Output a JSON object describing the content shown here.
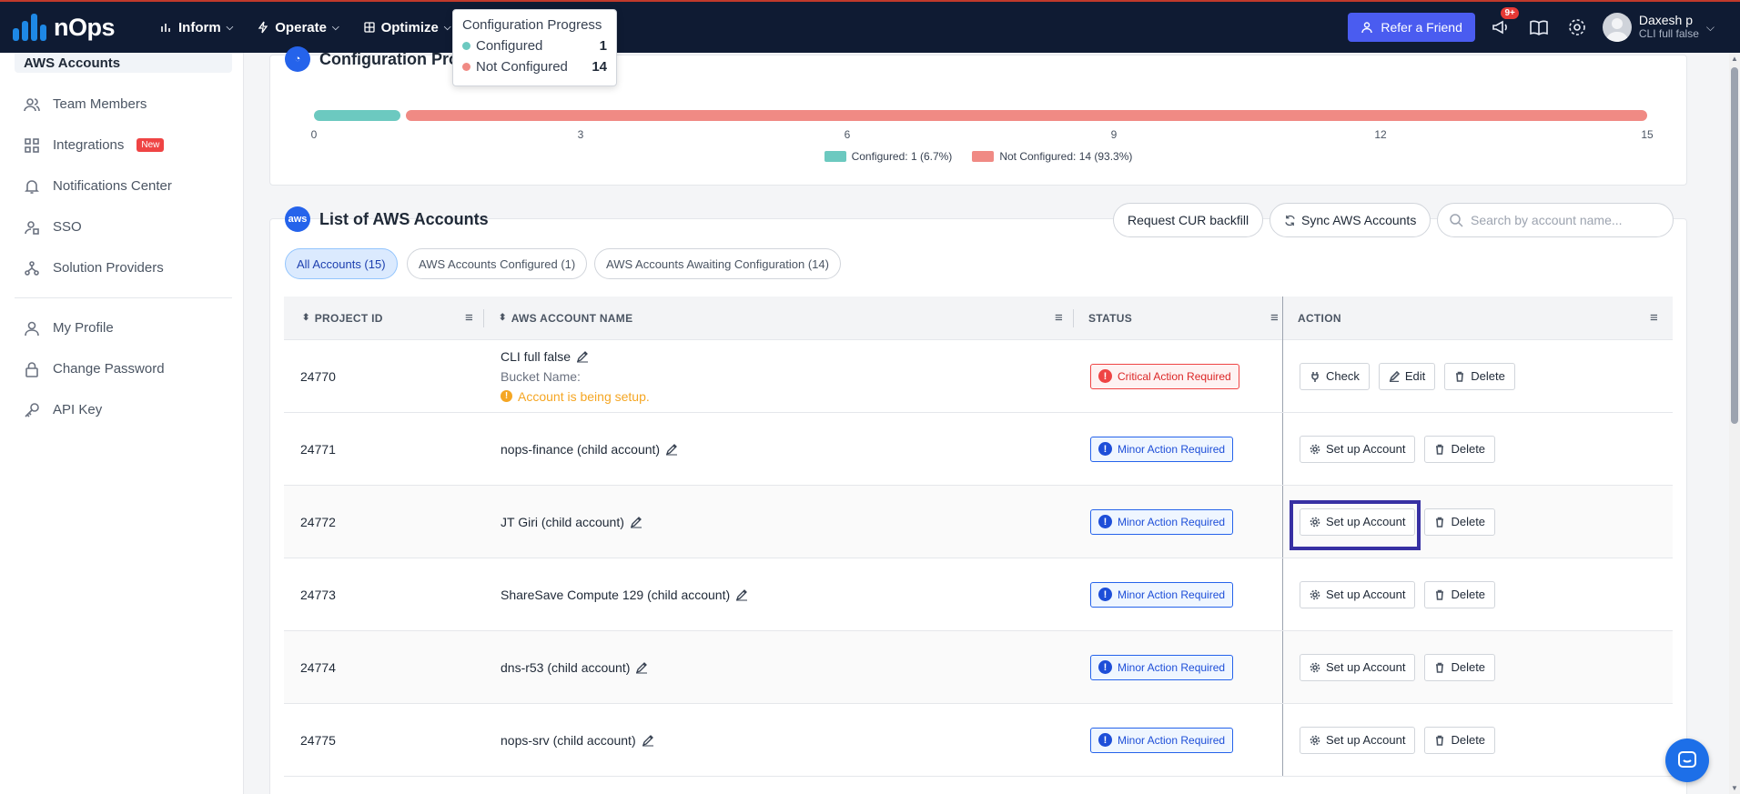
{
  "brand": {
    "name": "nOps"
  },
  "nav": [
    {
      "label": "Inform",
      "icon": "bar-chart-icon"
    },
    {
      "label": "Operate",
      "icon": "bolt-icon"
    },
    {
      "label": "Optimize",
      "icon": "layers-icon"
    }
  ],
  "header": {
    "refer_label": "Refer a Friend",
    "notif_count": "9+",
    "user_name": "Daxesh p",
    "user_sub": "CLI full false"
  },
  "sidebar": {
    "active": "AWS Accounts",
    "items": [
      {
        "label": "Team Members",
        "icon": "users-icon"
      },
      {
        "label": "Integrations",
        "icon": "grid-icon",
        "badge": "New"
      },
      {
        "label": "Notifications Center",
        "icon": "bell-icon"
      },
      {
        "label": "SSO",
        "icon": "sso-icon"
      },
      {
        "label": "Solution Providers",
        "icon": "network-icon"
      }
    ],
    "items2": [
      {
        "label": "My Profile",
        "icon": "user-icon"
      },
      {
        "label": "Change Password",
        "icon": "lock-icon"
      },
      {
        "label": "API Key",
        "icon": "key-icon"
      }
    ]
  },
  "progress": {
    "title": "Configuration Progress",
    "tick_labels": [
      "0",
      "3",
      "6",
      "9",
      "12",
      "15"
    ],
    "legend": [
      "Configured: 1 (6.7%)",
      "Not Configured: 14 (93.3%)"
    ],
    "colors": {
      "configured": "#6cc9c0",
      "not_configured": "#f08a84"
    }
  },
  "chart_data": {
    "type": "bar",
    "orientation": "horizontal-stacked",
    "title": "Configuration Progress",
    "series": [
      {
        "name": "Configured",
        "values": [
          1
        ]
      },
      {
        "name": "Not Configured",
        "values": [
          14
        ]
      }
    ],
    "xlim": [
      0,
      15
    ],
    "ticks": [
      0,
      3,
      6,
      9,
      12,
      15
    ],
    "legend_position": "bottom"
  },
  "tooltip": {
    "title": "Configuration Progress",
    "rows": [
      {
        "label": "Configured",
        "value": "1"
      },
      {
        "label": "Not Configured",
        "value": "14"
      }
    ]
  },
  "accounts": {
    "title": "List of AWS Accounts",
    "aws_label": "aws",
    "request_cur": "Request CUR backfill",
    "sync": "Sync AWS Accounts",
    "search_placeholder": "Search by account name...",
    "filters": [
      "All Accounts (15)",
      "AWS Accounts Configured (1)",
      "AWS Accounts Awaiting Configuration (14)"
    ],
    "columns": [
      "PROJECT ID",
      "AWS ACCOUNT NAME",
      "STATUS",
      "ACTION"
    ],
    "first_row": {
      "id": "24770",
      "name": "CLI full false",
      "bucket": "Bucket Name:",
      "setup": "Account is being setup.",
      "status": "Critical Action Required",
      "actions": [
        "Check",
        "Edit",
        "Delete"
      ]
    },
    "rows": [
      {
        "id": "24771",
        "name": "nops-finance (child account)",
        "status": "Minor Action Required"
      },
      {
        "id": "24772",
        "name": "JT Giri (child account)",
        "status": "Minor Action Required"
      },
      {
        "id": "24773",
        "name": "ShareSave Compute 129 (child account)",
        "status": "Minor Action Required"
      },
      {
        "id": "24774",
        "name": "dns-r53 (child account)",
        "status": "Minor Action Required"
      },
      {
        "id": "24775",
        "name": "nops-srv (child account)",
        "status": "Minor Action Required"
      }
    ],
    "setup_label": "Set up Account",
    "delete_label": "Delete"
  }
}
